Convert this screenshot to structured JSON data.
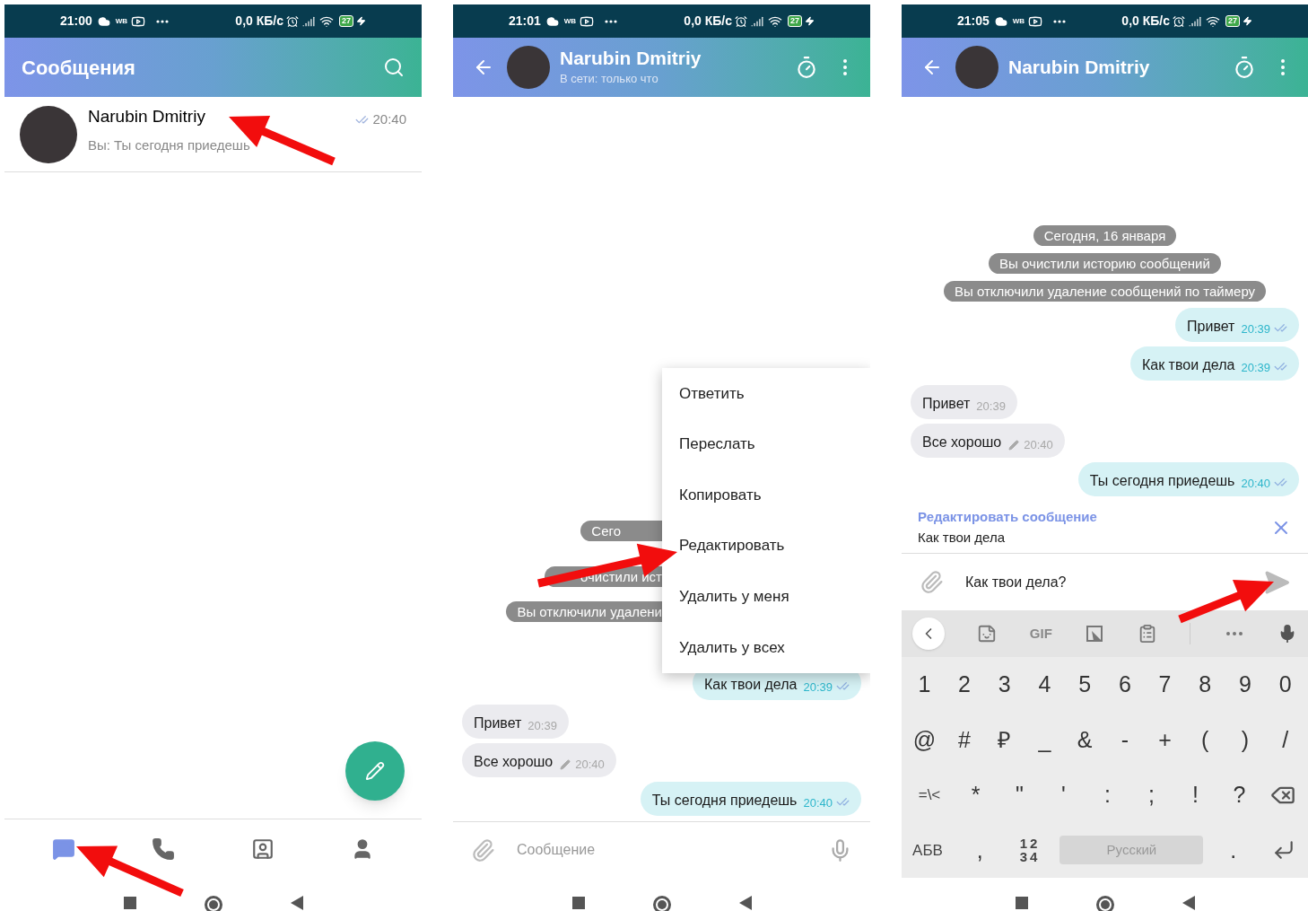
{
  "screens": [
    {
      "kind": "chat_list",
      "status_bar": {
        "time": "21:00",
        "app_label": "WB",
        "speed": "0,0 КБ/с",
        "battery": "27"
      },
      "app_bar": {
        "title": "Сообщения"
      },
      "chats": [
        {
          "name": "Narubin Dmitriy",
          "preview": "Вы: Ты сегодня приедешь",
          "time": "20:40",
          "read": true
        }
      ],
      "bottom_nav": [
        {
          "kind": "chats",
          "selected": true
        },
        {
          "kind": "calls",
          "selected": false
        },
        {
          "kind": "contacts",
          "selected": false
        },
        {
          "kind": "profile",
          "selected": false
        }
      ]
    },
    {
      "kind": "chat",
      "status_bar": {
        "time": "21:01",
        "app_label": "WB",
        "speed": "0,0 КБ/с",
        "battery": "27"
      },
      "header": {
        "name": "Narubin Dmitriy",
        "subtitle": "В сети: только что"
      },
      "service_messages": [
        "Сего",
        "очистили ист",
        "Вы отключили удалени"
      ],
      "messages": [
        {
          "kind": "out",
          "text": "Как твои дела",
          "time": "20:39",
          "read": true,
          "edited": false
        },
        {
          "kind": "in",
          "text": "Привет",
          "time": "20:39",
          "edited": false
        },
        {
          "kind": "in",
          "text": "Все хорошо",
          "time": "20:40",
          "edited": true
        },
        {
          "kind": "out",
          "text": "Ты сегодня приедешь",
          "time": "20:40",
          "read": true,
          "edited": false
        }
      ],
      "context_menu": [
        "Ответить",
        "Переслать",
        "Копировать",
        "Редактировать",
        "Удалить у меня",
        "Удалить у всех"
      ],
      "composer": {
        "placeholder": "Сообщение"
      }
    },
    {
      "kind": "chat",
      "status_bar": {
        "time": "21:05",
        "app_label": "WB",
        "speed": "0,0 КБ/с",
        "battery": "27"
      },
      "header": {
        "name": "Narubin Dmitriy"
      },
      "service_messages": [
        "Сегодня, 16 января",
        "Вы очистили историю сообщений",
        "Вы отключили удаление сообщений по таймеру"
      ],
      "messages": [
        {
          "kind": "out",
          "text": "Привет",
          "time": "20:39",
          "read": true,
          "edited": false
        },
        {
          "kind": "out",
          "text": "Как твои дела",
          "time": "20:39",
          "read": true,
          "edited": false
        },
        {
          "kind": "in",
          "text": "Привет",
          "time": "20:39",
          "edited": false
        },
        {
          "kind": "in",
          "text": "Все хорошо",
          "time": "20:40",
          "edited": true
        },
        {
          "kind": "out",
          "text": "Ты сегодня приедешь",
          "time": "20:40",
          "read": true,
          "edited": false
        }
      ],
      "edit_bar": {
        "title": "Редактировать сообщение",
        "text": "Как твои дела"
      },
      "composer": {
        "value": "Как твои дела?"
      },
      "keyboard": {
        "toolbar_label": "GIF",
        "key_rows": [
          {
            "kind": "number_row",
            "keys": [
              {
                "kind": "key",
                "label": "1"
              },
              {
                "kind": "key",
                "label": "2"
              },
              {
                "kind": "key",
                "label": "3"
              },
              {
                "kind": "key",
                "label": "4"
              },
              {
                "kind": "key",
                "label": "5"
              },
              {
                "kind": "key",
                "label": "6"
              },
              {
                "kind": "key",
                "label": "7"
              },
              {
                "kind": "key",
                "label": "8"
              },
              {
                "kind": "key",
                "label": "9"
              },
              {
                "kind": "key",
                "label": "0"
              }
            ]
          },
          {
            "kind": "symbol_row",
            "keys": [
              {
                "kind": "key",
                "label": "@"
              },
              {
                "kind": "key",
                "label": "#"
              },
              {
                "kind": "key",
                "label": "₽"
              },
              {
                "kind": "key",
                "label": "_"
              },
              {
                "kind": "key",
                "label": "&"
              },
              {
                "kind": "key",
                "label": "-"
              },
              {
                "kind": "key",
                "label": "+"
              },
              {
                "kind": "key",
                "label": "("
              },
              {
                "kind": "key",
                "label": ")"
              },
              {
                "kind": "key",
                "label": "/"
              }
            ]
          },
          {
            "kind": "punctuation_row",
            "keys": [
              {
                "kind": "small",
                "label": "=\\<"
              },
              {
                "kind": "key",
                "label": "*"
              },
              {
                "kind": "key",
                "label": "\""
              },
              {
                "kind": "key",
                "label": "'"
              },
              {
                "kind": "key",
                "label": ":"
              },
              {
                "kind": "key",
                "label": ";"
              },
              {
                "kind": "key",
                "label": "!"
              },
              {
                "kind": "key",
                "label": "?"
              },
              {
                "kind": "backspace"
              }
            ]
          },
          {
            "kind": "bottom_row",
            "keys": [
              {
                "kind": "small",
                "label": "АБВ"
              },
              {
                "kind": "key",
                "label": ","
              },
              {
                "kind": "stack",
                "lines": [
                  "12",
                  "34"
                ]
              },
              {
                "kind": "space",
                "label": "Русский"
              },
              {
                "kind": "key",
                "label": "."
              },
              {
                "kind": "enter"
              }
            ]
          }
        ]
      }
    }
  ]
}
